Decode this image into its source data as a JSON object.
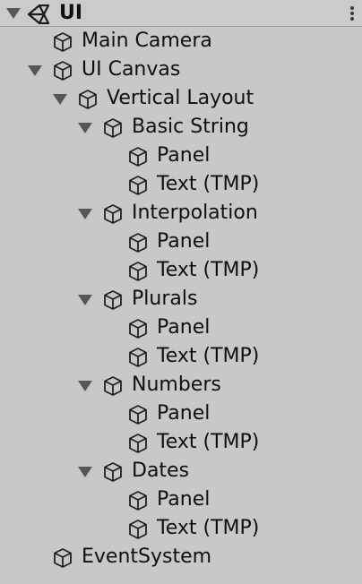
{
  "scene": {
    "title": "UI",
    "icon": "unity-logo-icon",
    "menu_icon": "kebab-menu-icon",
    "expanded": true
  },
  "hierarchy": [
    {
      "label": "Main Camera",
      "depth": 1,
      "has_children": false
    },
    {
      "label": "UI Canvas",
      "depth": 1,
      "has_children": true,
      "expanded": true
    },
    {
      "label": "Vertical Layout",
      "depth": 2,
      "has_children": true,
      "expanded": true
    },
    {
      "label": "Basic String",
      "depth": 3,
      "has_children": true,
      "expanded": true
    },
    {
      "label": "Panel",
      "depth": 4,
      "has_children": false
    },
    {
      "label": "Text (TMP)",
      "depth": 4,
      "has_children": false
    },
    {
      "label": "Interpolation",
      "depth": 3,
      "has_children": true,
      "expanded": true
    },
    {
      "label": "Panel",
      "depth": 4,
      "has_children": false
    },
    {
      "label": "Text (TMP)",
      "depth": 4,
      "has_children": false
    },
    {
      "label": "Plurals",
      "depth": 3,
      "has_children": true,
      "expanded": true
    },
    {
      "label": "Panel",
      "depth": 4,
      "has_children": false
    },
    {
      "label": "Text (TMP)",
      "depth": 4,
      "has_children": false
    },
    {
      "label": "Numbers",
      "depth": 3,
      "has_children": true,
      "expanded": true
    },
    {
      "label": "Panel",
      "depth": 4,
      "has_children": false
    },
    {
      "label": "Text (TMP)",
      "depth": 4,
      "has_children": false
    },
    {
      "label": "Dates",
      "depth": 3,
      "has_children": true,
      "expanded": true
    },
    {
      "label": "Panel",
      "depth": 4,
      "has_children": false
    },
    {
      "label": "Text (TMP)",
      "depth": 4,
      "has_children": false
    },
    {
      "label": "EventSystem",
      "depth": 1,
      "has_children": false
    }
  ],
  "icons": {
    "gameobject": "cube-icon",
    "fold_expanded": "triangle-down-icon"
  }
}
